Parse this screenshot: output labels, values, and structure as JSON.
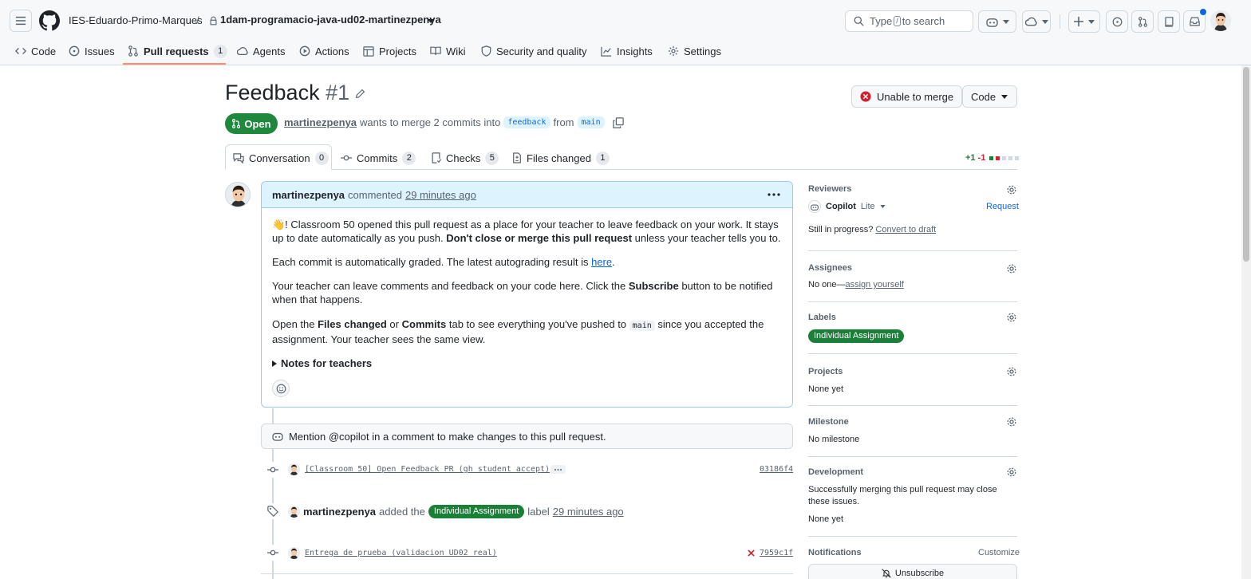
{
  "header": {
    "owner": "IES-Eduardo-Primo-Marques",
    "separator": "/",
    "repo": "1dam-programacio-java-ud02-martinezpenya",
    "search_prefix": "Type",
    "search_key": "/",
    "search_suffix": "to search"
  },
  "nav": {
    "tabs": [
      {
        "label": "Code",
        "icon": "code-icon"
      },
      {
        "label": "Issues",
        "icon": "issue-opened-icon"
      },
      {
        "label": "Pull requests",
        "icon": "git-pull-request-icon",
        "count": "1"
      },
      {
        "label": "Agents",
        "icon": "agent-icon"
      },
      {
        "label": "Actions",
        "icon": "play-icon"
      },
      {
        "label": "Projects",
        "icon": "table-icon"
      },
      {
        "label": "Wiki",
        "icon": "book-icon"
      },
      {
        "label": "Security and quality",
        "icon": "shield-icon"
      },
      {
        "label": "Insights",
        "icon": "graph-icon"
      },
      {
        "label": "Settings",
        "icon": "gear-icon"
      }
    ]
  },
  "pr": {
    "title": "Feedback",
    "number": "#1",
    "status": "Open",
    "author": "martinezpenya",
    "meta_text": "wants to merge 2 commits into",
    "base_branch": "feedback",
    "from_text": "from",
    "head_branch": "main",
    "merge_button": "Unable to merge",
    "code_button": "Code"
  },
  "pr_tabs": [
    {
      "label": "Conversation",
      "count": "0"
    },
    {
      "label": "Commits",
      "count": "2"
    },
    {
      "label": "Checks",
      "count": "5"
    },
    {
      "label": "Files changed",
      "count": "1"
    }
  ],
  "diffstat": {
    "added": "+1",
    "removed": "-1"
  },
  "comment": {
    "author": "martinezpenya",
    "action": "commented",
    "time": "29 minutes ago",
    "p1_a": "👋! Classroom 50 opened this pull request as a place for your teacher to leave feedback on your work. It stays up to date automatically as you push. ",
    "p1_b": "Don't close or merge this pull request",
    "p1_c": " unless your teacher tells you to.",
    "p2_a": "Each commit is automatically graded. The latest autograding result is ",
    "p2_link": "here",
    "p2_b": ".",
    "p3_a": "Your teacher can leave comments and feedback on your code here. Click the ",
    "p3_b": "Subscribe",
    "p3_c": " button to be notified when that happens.",
    "p4_a": "Open the ",
    "p4_b": "Files changed",
    "p4_c": " or ",
    "p4_d": "Commits",
    "p4_e": " tab to see everything you've pushed to ",
    "p4_code": "main",
    "p4_f": " since you accepted the assignment. Your teacher sees the same view.",
    "details": "Notes for teachers"
  },
  "timeline": {
    "copilot_note": "Mention @copilot in a comment to make changes to this pull request.",
    "commit1_msg": "[Classroom 50] Open Feedback PR (gh student accept)",
    "commit1_sha": "03186f4",
    "label_event_user": "martinezpenya",
    "label_event_added": "added the",
    "label_event_label": "Individual Assignment",
    "label_event_suffix": "label",
    "label_event_time": "29 minutes ago",
    "commit2_msg": "Entrega de prueba (validacion UD02 real)",
    "commit2_sha": "7959c1f"
  },
  "sidebar": {
    "reviewers_title": "Reviewers",
    "reviewer_name": "Copilot",
    "reviewer_tier": "Lite",
    "request_link": "Request",
    "draft_text": "Still in progress?",
    "draft_link": "Convert to draft",
    "assignees_title": "Assignees",
    "assignees_text": "No one—",
    "assignees_link": "assign yourself",
    "labels_title": "Labels",
    "label_pill": "Individual Assignment",
    "projects_title": "Projects",
    "projects_text": "None yet",
    "milestone_title": "Milestone",
    "milestone_text": "No milestone",
    "development_title": "Development",
    "development_text": "Successfully merging this pull request may close these issues.",
    "development_none": "None yet",
    "notifications_title": "Notifications",
    "customize_link": "Customize",
    "unsubscribe_button": "Unsubscribe"
  },
  "colors": {
    "accent": "#0969da",
    "open_green": "#1f883d",
    "label_green": "#1a7f37",
    "tab_underline": "#fd8c73",
    "danger": "#cf222e"
  }
}
